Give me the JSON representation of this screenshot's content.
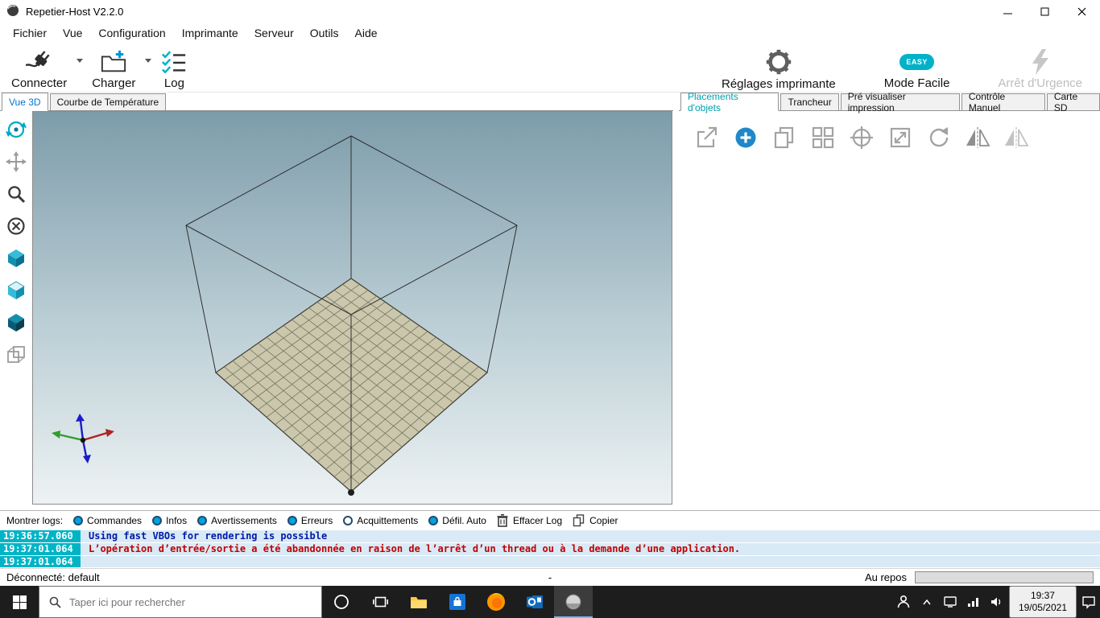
{
  "window": {
    "title": "Repetier-Host V2.2.0"
  },
  "menu": {
    "items": [
      "Fichier",
      "Vue",
      "Configuration",
      "Imprimante",
      "Serveur",
      "Outils",
      "Aide"
    ]
  },
  "toolbar": {
    "connect_label": "Connecter",
    "load_label": "Charger",
    "log_label": "Log",
    "printer_settings_label": "Réglages imprimante",
    "easy_badge": "EASY",
    "easy_label": "Mode Facile",
    "emergency_label": "Arrêt d'Urgence"
  },
  "left_tabs": {
    "view3d": "Vue 3D",
    "temperature": "Courbe de Température"
  },
  "right_tabs": {
    "placement": "Placements d'objets",
    "slicer": "Trancheur",
    "preview": "Pré visualiser impression",
    "manual": "Contrôle Manuel",
    "sd": "Carte SD"
  },
  "log": {
    "show_label": "Montrer logs:",
    "filters": [
      {
        "label": "Commandes",
        "on": true
      },
      {
        "label": "Infos",
        "on": true
      },
      {
        "label": "Avertissements",
        "on": true
      },
      {
        "label": "Erreurs",
        "on": true
      },
      {
        "label": "Acquittements",
        "on": false
      },
      {
        "label": "Défil. Auto",
        "on": true
      }
    ],
    "clear_label": "Effacer Log",
    "copy_label": "Copier",
    "entries": [
      {
        "time": "19:36:57.060",
        "text": "Using fast VBOs for rendering is possible",
        "type": "info"
      },
      {
        "time": "19:37:01.064",
        "text": "L’opération d’entrée/sortie a été abandonnée en raison de l’arrêt d’un thread ou à la demande d’une application.",
        "type": "error"
      },
      {
        "time": "19:37:01.064",
        "text": "",
        "type": "info"
      }
    ]
  },
  "statusbar": {
    "connection": "Déconnecté: default",
    "center": "-",
    "state": "Au repos"
  },
  "taskbar": {
    "search_placeholder": "Taper ici pour rechercher",
    "time": "19:37",
    "date": "19/05/2021"
  },
  "colors": {
    "accent_teal": "#00b2c8",
    "tab_active_left": "#0077c8",
    "tab_active_right": "#00a0ae",
    "log_time_bg": "#00b4c6",
    "log_row_bg": "#d9eaf6",
    "info_text": "#0018a8",
    "error_text": "#c00000"
  },
  "icons": {
    "connect": "plug-icon",
    "load": "folder-plus-icon",
    "log": "checklist-icon",
    "printer_settings": "gear-icon",
    "emergency": "lightning-icon",
    "clear_log": "trash-icon",
    "copy_log": "copy-pages-icon",
    "add_object": "plus-circle-icon",
    "search": "search-icon",
    "start": "windows-logo-icon"
  }
}
